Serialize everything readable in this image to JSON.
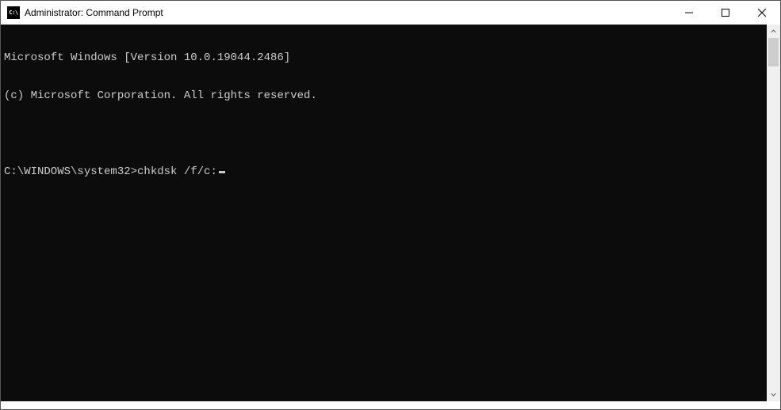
{
  "window": {
    "title": "Administrator: Command Prompt",
    "icon_label": "C:\\"
  },
  "console": {
    "line1": "Microsoft Windows [Version 10.0.19044.2486]",
    "line2": "(c) Microsoft Corporation. All rights reserved.",
    "blank": "",
    "prompt": "C:\\WINDOWS\\system32>",
    "command": "chkdsk /f/c:"
  }
}
